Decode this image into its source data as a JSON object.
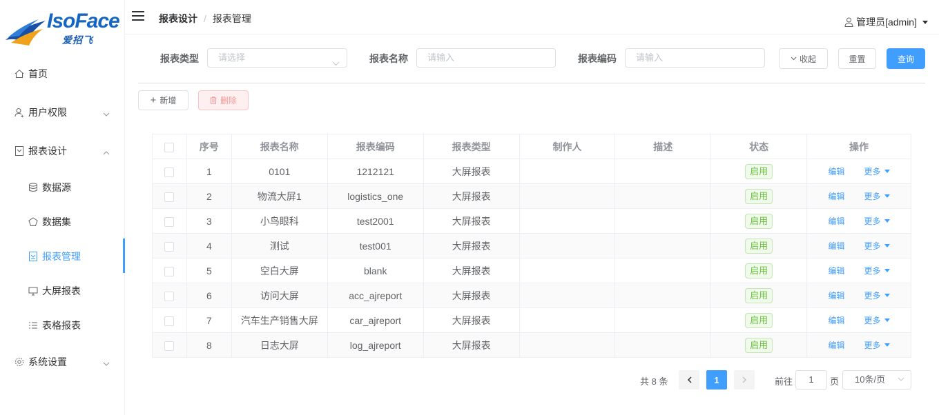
{
  "brand": {
    "name": "IsoFace",
    "tagline": "爱招飞"
  },
  "sidebar": {
    "items": [
      {
        "label": "首页",
        "icon": "home-icon"
      },
      {
        "label": "用户权限",
        "icon": "user-icon"
      },
      {
        "label": "报表设计",
        "icon": "report-icon"
      },
      {
        "label": "数据源",
        "icon": "database-icon"
      },
      {
        "label": "数据集",
        "icon": "dataset-icon"
      },
      {
        "label": "报表管理",
        "icon": "report-manage-icon"
      },
      {
        "label": "大屏报表",
        "icon": "monitor-icon"
      },
      {
        "label": "表格报表",
        "icon": "list-icon"
      },
      {
        "label": "系统设置",
        "icon": "gear-icon"
      }
    ]
  },
  "header": {
    "breadcrumb": [
      "报表设计",
      "报表管理"
    ],
    "user": "管理员[admin]"
  },
  "filter": {
    "type_label": "报表类型",
    "type_placeholder": "请选择",
    "name_label": "报表名称",
    "name_placeholder": "请输入",
    "code_label": "报表编码",
    "code_placeholder": "请输入",
    "collapse_label": "收起",
    "reset_label": "重置",
    "query_label": "查询"
  },
  "toolbar": {
    "add_label": "新增",
    "delete_label": "删除"
  },
  "table": {
    "columns": [
      "序号",
      "报表名称",
      "报表编码",
      "报表类型",
      "制作人",
      "描述",
      "状态",
      "操作"
    ],
    "rows": [
      {
        "no": "1",
        "name": "0101",
        "code": "1212121",
        "type": "大屏报表",
        "author": "",
        "desc": "",
        "status": "启用"
      },
      {
        "no": "2",
        "name": "物流大屏1",
        "code": "logistics_one",
        "type": "大屏报表",
        "author": "",
        "desc": "",
        "status": "启用"
      },
      {
        "no": "3",
        "name": "小鸟眼科",
        "code": "test2001",
        "type": "大屏报表",
        "author": "",
        "desc": "",
        "status": "启用"
      },
      {
        "no": "4",
        "name": "测试",
        "code": "test001",
        "type": "大屏报表",
        "author": "",
        "desc": "",
        "status": "启用"
      },
      {
        "no": "5",
        "name": "空白大屏",
        "code": "blank",
        "type": "大屏报表",
        "author": "",
        "desc": "",
        "status": "启用"
      },
      {
        "no": "6",
        "name": "访问大屏",
        "code": "acc_ajreport",
        "type": "大屏报表",
        "author": "",
        "desc": "",
        "status": "启用"
      },
      {
        "no": "7",
        "name": "汽车生产销售大屏",
        "code": "car_ajreport",
        "type": "大屏报表",
        "author": "",
        "desc": "",
        "status": "启用"
      },
      {
        "no": "8",
        "name": "日志大屏",
        "code": "log_ajreport",
        "type": "大屏报表",
        "author": "",
        "desc": "",
        "status": "启用"
      }
    ],
    "edit_label": "编辑",
    "more_label": "更多"
  },
  "pagination": {
    "total_text": "共 8 条",
    "current_page": "1",
    "goto_label": "前往",
    "goto_value": "1",
    "page_suffix": "页",
    "page_size": "10条/页"
  },
  "colors": {
    "primary": "#409eff",
    "success": "#67c23a",
    "danger_light": "#f89898"
  }
}
